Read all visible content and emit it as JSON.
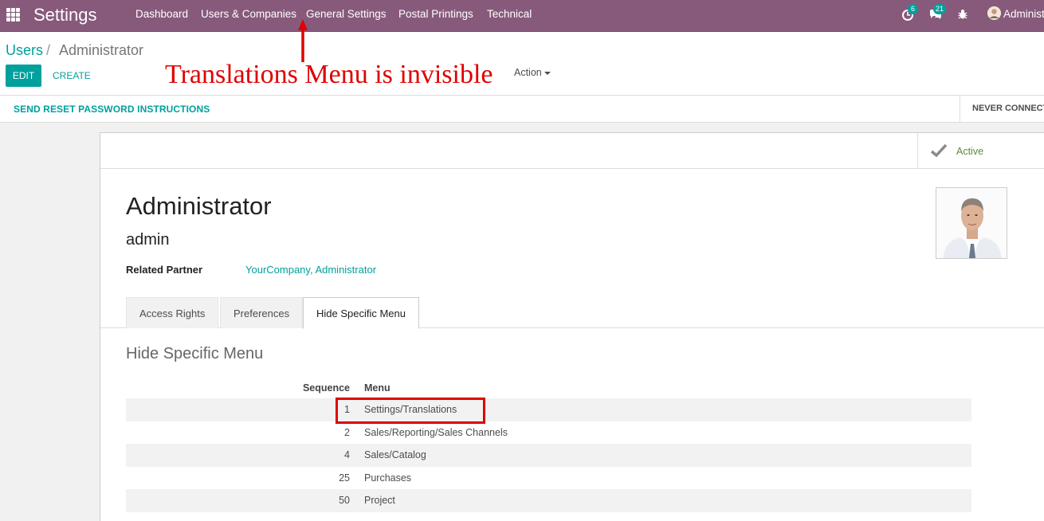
{
  "topbar": {
    "app_title": "Settings",
    "menu": [
      "Dashboard",
      "Users & Companies",
      "General Settings",
      "Postal Printings",
      "Technical"
    ],
    "activity_count": "6",
    "messages_count": "21",
    "user_name": "Administrator",
    "icons": [
      "apps-grid-icon",
      "activity-clock-icon",
      "chat-icon",
      "bug-icon",
      "user-avatar-icon"
    ],
    "color": "#875a7b"
  },
  "breadcrumb": {
    "parent": "Users",
    "separator": "/",
    "current": "Administrator"
  },
  "buttons": {
    "edit": "EDIT",
    "create": "CREATE",
    "action": "Action"
  },
  "annotation": {
    "text": "Translations Menu is invisible"
  },
  "statusbar": {
    "reset_password": "SEND RESET PASSWORD INSTRUCTIONS",
    "state": "NEVER CONNECTED"
  },
  "smart_button": {
    "label": "Active"
  },
  "form": {
    "name": "Administrator",
    "login": "admin",
    "related_partner_label": "Related Partner",
    "related_partner_value": "YourCompany, Administrator"
  },
  "tabs": [
    "Access Rights",
    "Preferences",
    "Hide Specific Menu"
  ],
  "active_tab": "Hide Specific Menu",
  "section": {
    "title": "Hide Specific Menu"
  },
  "table": {
    "columns": [
      "Sequence",
      "Menu"
    ],
    "rows": [
      {
        "sequence": "1",
        "menu": "Settings/Translations"
      },
      {
        "sequence": "2",
        "menu": "Sales/Reporting/Sales Channels"
      },
      {
        "sequence": "4",
        "menu": "Sales/Catalog"
      },
      {
        "sequence": "25",
        "menu": "Purchases"
      },
      {
        "sequence": "50",
        "menu": "Project"
      }
    ]
  },
  "colors": {
    "accent": "#00a09d",
    "annotation": "#e00000"
  }
}
